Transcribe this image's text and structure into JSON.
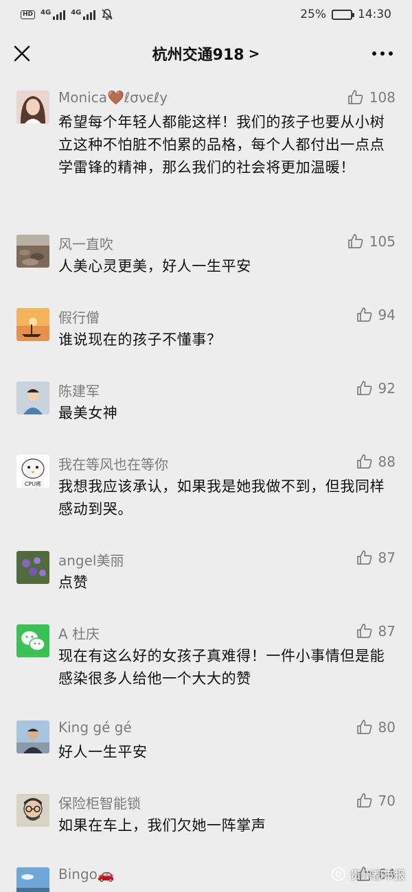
{
  "status_bar": {
    "network_1": "4G",
    "network_2": "4G",
    "hd": "HD",
    "battery": "25%",
    "battery_level": 0.25,
    "time": "14:30"
  },
  "nav": {
    "title": "杭州交通918",
    "chevron": ">"
  },
  "comments": [
    {
      "name": "Monica🤎ℓσνєℓу",
      "likes": "108",
      "text": "希望每个年轻人都能这样！我们的孩子也要从小树立这种不怕脏不怕累的品格，每个人都付出一点点学雷锋的精神，那么我们的社会将更加温暖！",
      "avatar": "portrait-woman"
    },
    {
      "name": "风一直吹",
      "likes": "105",
      "text": "人美心灵更美，好人一生平安",
      "avatar": "stones"
    },
    {
      "name": "假行僧",
      "likes": "94",
      "text": "谁说现在的孩子不懂事？",
      "avatar": "sunset-boat"
    },
    {
      "name": "陈建军",
      "likes": "92",
      "text": "最美女神",
      "avatar": "child"
    },
    {
      "name": "我在等风也在等你",
      "likes": "88",
      "text": "我想我应该承认，如果我是她我做不到，但我同样感动到哭。",
      "avatar": "cartoon-bird",
      "avatar_text": "CPU疼"
    },
    {
      "name": "angel美丽",
      "likes": "87",
      "text": "点赞",
      "avatar": "purple-flowers"
    },
    {
      "name": "A 杜庆",
      "likes": "87",
      "text": "现在有这么好的女孩子真难得！一件小事情但是能感染很多人给他一个大大的赞",
      "avatar": "wechat-logo"
    },
    {
      "name": "King gé gé",
      "likes": "80",
      "text": "好人一生平安",
      "avatar": "man-photo"
    },
    {
      "name": "保险柜智能锁",
      "likes": "70",
      "text": "如果在车上，我们欠她一阵掌声",
      "avatar": "cartoon-glasses"
    },
    {
      "name": "Bingo🚗",
      "likes": "64",
      "text": "",
      "avatar": "blue-sky"
    }
  ],
  "watermark": "贵州都市报",
  "colors": {
    "background": "#ededed",
    "meta_gray": "#7c7c7c",
    "text": "#111111",
    "wechat_green": "#3ac255"
  }
}
